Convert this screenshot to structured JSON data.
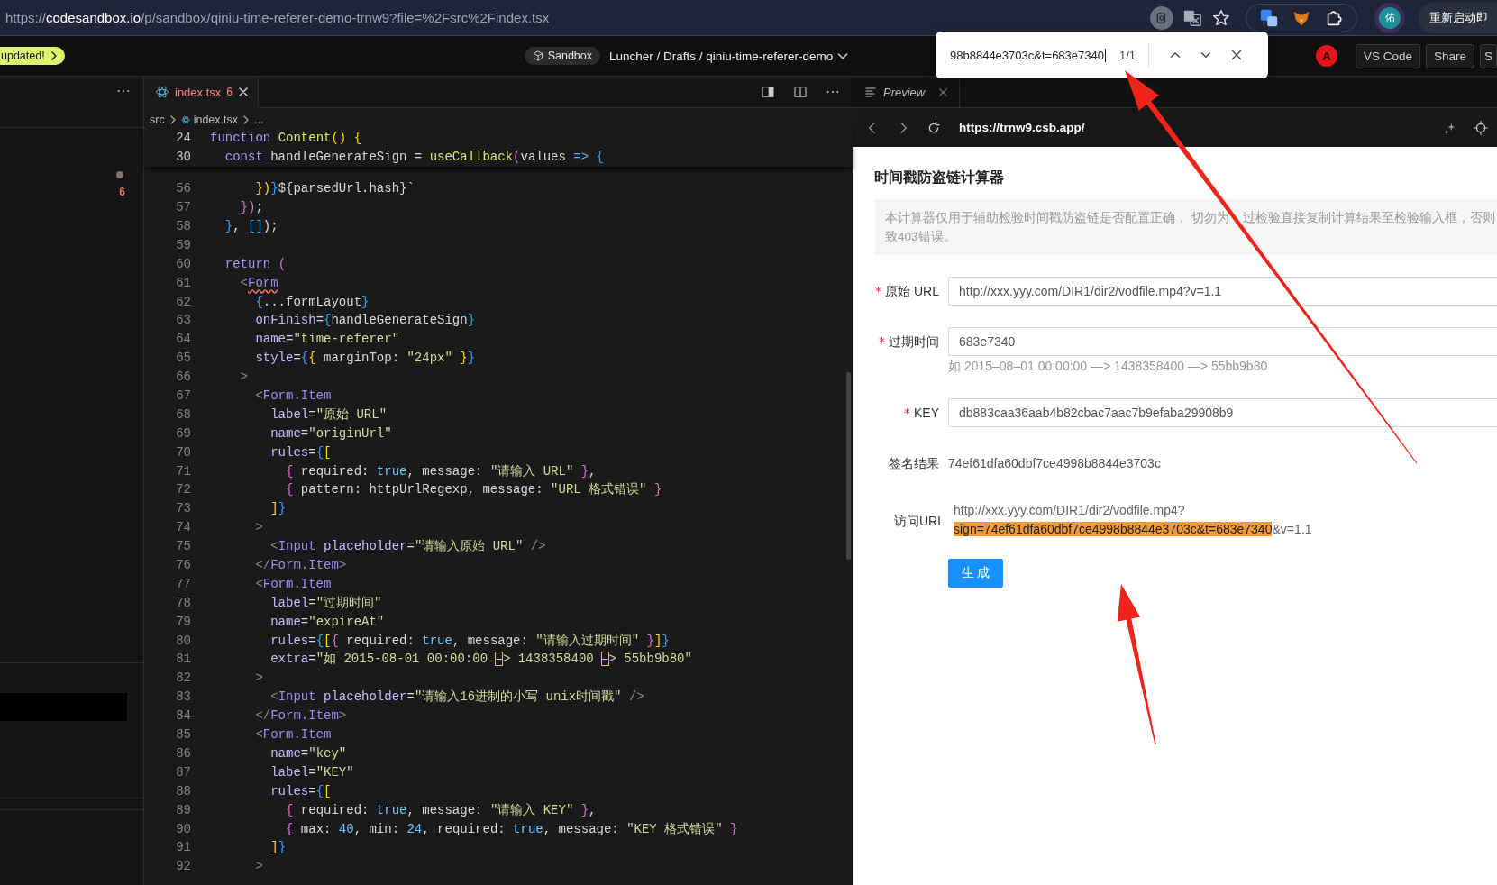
{
  "browser": {
    "url_scheme": "https://",
    "url_host": "codesandbox.io",
    "url_path": "/p/sandbox/qiniu-time-referer-demo-trnw9?file=%2Fsrc%2Findex.tsx",
    "profile_initial": "佑",
    "relaunch_button": "重新启动即"
  },
  "header": {
    "update_badge": "updated!",
    "sandbox_badge": "Sandbox",
    "breadcrumb": "Luncher / Drafts / qiniu-time-referer-demo",
    "avatar_initial": "A",
    "buttons": [
      "VS Code",
      "Share",
      "S"
    ]
  },
  "find_widget": {
    "query": "98b8844e3703c&t=683e7340",
    "match_count": "1/1"
  },
  "sidebar": {
    "problem_count": "6"
  },
  "editor": {
    "tab": {
      "label": "index.tsx",
      "problems": "6"
    },
    "breadcrumb": [
      "src",
      "index.tsx",
      "..."
    ],
    "sticky_lines": [
      {
        "number": "24",
        "tokens": [
          {
            "kind": "keyword",
            "text": "function "
          },
          {
            "kind": "function",
            "text": "Content"
          },
          {
            "kind": "bracket1",
            "text": "() {"
          }
        ]
      },
      {
        "number": "30",
        "tokens": [
          {
            "kind": "keyword",
            "text": "  const"
          },
          {
            "kind": "plain",
            "text": " handleGenerateSign = "
          },
          {
            "kind": "function",
            "text": "useCallback"
          },
          {
            "kind": "bracket2",
            "text": "("
          },
          {
            "kind": "plain",
            "text": "values "
          },
          {
            "kind": "op",
            "text": "=> "
          },
          {
            "kind": "bracket3",
            "text": "{"
          }
        ]
      }
    ],
    "lines": [
      {
        "number": "56",
        "tokens": [
          {
            "kind": "bracket1",
            "text": "      })"
          },
          {
            "kind": "bracket3",
            "text": "}"
          },
          {
            "kind": "plain",
            "text": "${parsedUrl.hash}`"
          }
        ]
      },
      {
        "number": "57",
        "tokens": [
          {
            "kind": "bracket2",
            "text": "    })"
          },
          {
            "kind": "plain",
            "text": ";"
          }
        ]
      },
      {
        "number": "58",
        "tokens": [
          {
            "kind": "bracket3",
            "text": "  }"
          },
          {
            "kind": "plain",
            "text": ", "
          },
          {
            "kind": "bracket3",
            "text": "[]"
          },
          {
            "kind": "plain",
            "text": ");"
          }
        ]
      },
      {
        "number": "59"
      },
      {
        "number": "60",
        "tokens": [
          {
            "kind": "keyword",
            "text": "  return "
          },
          {
            "kind": "bracket2",
            "text": "("
          }
        ]
      },
      {
        "number": "61",
        "tokens": [
          {
            "kind": "punct",
            "text": "    <"
          },
          {
            "kind": "tag-error",
            "text": "Form"
          }
        ]
      },
      {
        "number": "62",
        "tokens": [
          {
            "kind": "bracket3",
            "text": "      {"
          },
          {
            "kind": "plain",
            "text": "...formLayout"
          },
          {
            "kind": "bracket3",
            "text": "}"
          }
        ]
      },
      {
        "number": "63",
        "tokens": [
          {
            "kind": "attr",
            "text": "      onFinish"
          },
          {
            "kind": "plain",
            "text": "="
          },
          {
            "kind": "bracket3",
            "text": "{"
          },
          {
            "kind": "plain",
            "text": "handleGenerateSign"
          },
          {
            "kind": "bracket3",
            "text": "}"
          }
        ]
      },
      {
        "number": "64",
        "tokens": [
          {
            "kind": "attr",
            "text": "      name"
          },
          {
            "kind": "plain",
            "text": "="
          },
          {
            "kind": "string",
            "text": "\"time-referer\""
          }
        ]
      },
      {
        "number": "65",
        "tokens": [
          {
            "kind": "attr",
            "text": "      style"
          },
          {
            "kind": "plain",
            "text": "="
          },
          {
            "kind": "bracket3",
            "text": "{"
          },
          {
            "kind": "bracket1",
            "text": "{"
          },
          {
            "kind": "plain",
            "text": " marginTop: "
          },
          {
            "kind": "string",
            "text": "\"24px\""
          },
          {
            "kind": "bracket1",
            "text": " }"
          },
          {
            "kind": "bracket3",
            "text": "}"
          }
        ]
      },
      {
        "number": "66",
        "tokens": [
          {
            "kind": "punct",
            "text": "    >"
          }
        ]
      },
      {
        "number": "67",
        "tokens": [
          {
            "kind": "punct",
            "text": "      <"
          },
          {
            "kind": "tag",
            "text": "Form.Item"
          }
        ]
      },
      {
        "number": "68",
        "tokens": [
          {
            "kind": "attr",
            "text": "        label"
          },
          {
            "kind": "plain",
            "text": "="
          },
          {
            "kind": "string",
            "text": "\"原始 URL\""
          }
        ]
      },
      {
        "number": "69",
        "tokens": [
          {
            "kind": "attr",
            "text": "        name"
          },
          {
            "kind": "plain",
            "text": "="
          },
          {
            "kind": "string",
            "text": "\"originUrl\""
          }
        ]
      },
      {
        "number": "70",
        "tokens": [
          {
            "kind": "attr",
            "text": "        rules"
          },
          {
            "kind": "plain",
            "text": "="
          },
          {
            "kind": "bracket3",
            "text": "{"
          },
          {
            "kind": "bracket1",
            "text": "["
          }
        ]
      },
      {
        "number": "71",
        "tokens": [
          {
            "kind": "bracket2",
            "text": "          {"
          },
          {
            "kind": "plain",
            "text": " required: "
          },
          {
            "kind": "bool",
            "text": "true"
          },
          {
            "kind": "plain",
            "text": ", message: "
          },
          {
            "kind": "string",
            "text": "\"请输入 URL\""
          },
          {
            "kind": "bracket2",
            "text": " }"
          },
          {
            "kind": "plain",
            "text": ","
          }
        ]
      },
      {
        "number": "72",
        "tokens": [
          {
            "kind": "bracket2",
            "text": "          {"
          },
          {
            "kind": "plain",
            "text": " pattern: httpUrlRegexp, message: "
          },
          {
            "kind": "string",
            "text": "\"URL 格式错误\""
          },
          {
            "kind": "bracket2",
            "text": " }"
          }
        ]
      },
      {
        "number": "73",
        "tokens": [
          {
            "kind": "bracket1",
            "text": "        ]"
          },
          {
            "kind": "bracket3",
            "text": "}"
          }
        ]
      },
      {
        "number": "74",
        "tokens": [
          {
            "kind": "punct",
            "text": "      >"
          }
        ]
      },
      {
        "number": "75",
        "tokens": [
          {
            "kind": "punct",
            "text": "        <"
          },
          {
            "kind": "tag",
            "text": "Input"
          },
          {
            "kind": "attr",
            "text": " placeholder"
          },
          {
            "kind": "plain",
            "text": "="
          },
          {
            "kind": "string",
            "text": "\"请输入原始 URL\""
          },
          {
            "kind": "punct",
            "text": " />"
          }
        ]
      },
      {
        "number": "76",
        "tokens": [
          {
            "kind": "punct",
            "text": "      </"
          },
          {
            "kind": "tag",
            "text": "Form.Item"
          },
          {
            "kind": "punct",
            "text": ">"
          }
        ]
      },
      {
        "number": "77",
        "tokens": [
          {
            "kind": "punct",
            "text": "      <"
          },
          {
            "kind": "tag",
            "text": "Form.Item"
          }
        ]
      },
      {
        "number": "78",
        "tokens": [
          {
            "kind": "attr",
            "text": "        label"
          },
          {
            "kind": "plain",
            "text": "="
          },
          {
            "kind": "string",
            "text": "\"过期时间\""
          }
        ]
      },
      {
        "number": "79",
        "tokens": [
          {
            "kind": "attr",
            "text": "        name"
          },
          {
            "kind": "plain",
            "text": "="
          },
          {
            "kind": "string",
            "text": "\"expireAt\""
          }
        ]
      },
      {
        "number": "80",
        "tokens": [
          {
            "kind": "attr",
            "text": "        rules"
          },
          {
            "kind": "plain",
            "text": "="
          },
          {
            "kind": "bracket3",
            "text": "{"
          },
          {
            "kind": "bracket1",
            "text": "["
          },
          {
            "kind": "bracket2",
            "text": "{"
          },
          {
            "kind": "plain",
            "text": " required: "
          },
          {
            "kind": "bool",
            "text": "true"
          },
          {
            "kind": "plain",
            "text": ", message: "
          },
          {
            "kind": "string",
            "text": "\"请输入过期时间\""
          },
          {
            "kind": "bracket2",
            "text": " }"
          },
          {
            "kind": "bracket1",
            "text": "]"
          },
          {
            "kind": "bracket3",
            "text": "}"
          }
        ]
      },
      {
        "number": "81",
        "tokens": [
          {
            "kind": "attr",
            "text": "        extra"
          },
          {
            "kind": "plain",
            "text": "="
          },
          {
            "kind": "string",
            "text": "\"如 2015-08-01 00:00:00 "
          },
          {
            "kind": "flagged",
            "text": "–"
          },
          {
            "kind": "string",
            "text": "> 1438358400 "
          },
          {
            "kind": "flagged",
            "text": "–"
          },
          {
            "kind": "string",
            "text": "> 55bb9b80\""
          }
        ]
      },
      {
        "number": "82",
        "tokens": [
          {
            "kind": "punct",
            "text": "      >"
          }
        ]
      },
      {
        "number": "83",
        "tokens": [
          {
            "kind": "punct",
            "text": "        <"
          },
          {
            "kind": "tag",
            "text": "Input"
          },
          {
            "kind": "attr",
            "text": " placeholder"
          },
          {
            "kind": "plain",
            "text": "="
          },
          {
            "kind": "string",
            "text": "\"请输入16进制的小写 unix时间戳\""
          },
          {
            "kind": "punct",
            "text": " />"
          }
        ]
      },
      {
        "number": "84",
        "tokens": [
          {
            "kind": "punct",
            "text": "      </"
          },
          {
            "kind": "tag",
            "text": "Form.Item"
          },
          {
            "kind": "punct",
            "text": ">"
          }
        ]
      },
      {
        "number": "85",
        "tokens": [
          {
            "kind": "punct",
            "text": "      <"
          },
          {
            "kind": "tag",
            "text": "Form.Item"
          }
        ]
      },
      {
        "number": "86",
        "tokens": [
          {
            "kind": "attr",
            "text": "        name"
          },
          {
            "kind": "plain",
            "text": "="
          },
          {
            "kind": "string",
            "text": "\"key\""
          }
        ]
      },
      {
        "number": "87",
        "tokens": [
          {
            "kind": "attr",
            "text": "        label"
          },
          {
            "kind": "plain",
            "text": "="
          },
          {
            "kind": "string",
            "text": "\"KEY\""
          }
        ]
      },
      {
        "number": "88",
        "tokens": [
          {
            "kind": "attr",
            "text": "        rules"
          },
          {
            "kind": "plain",
            "text": "="
          },
          {
            "kind": "bracket3",
            "text": "{"
          },
          {
            "kind": "bracket1",
            "text": "["
          }
        ]
      },
      {
        "number": "89",
        "tokens": [
          {
            "kind": "bracket2",
            "text": "          {"
          },
          {
            "kind": "plain",
            "text": " required: "
          },
          {
            "kind": "bool",
            "text": "true"
          },
          {
            "kind": "plain",
            "text": ", message: "
          },
          {
            "kind": "string",
            "text": "\"请输入 KEY\""
          },
          {
            "kind": "bracket2",
            "text": " }"
          },
          {
            "kind": "plain",
            "text": ","
          }
        ]
      },
      {
        "number": "90",
        "tokens": [
          {
            "kind": "bracket2",
            "text": "          {"
          },
          {
            "kind": "plain",
            "text": " max: "
          },
          {
            "kind": "number",
            "text": "40"
          },
          {
            "kind": "plain",
            "text": ", min: "
          },
          {
            "kind": "number",
            "text": "24"
          },
          {
            "kind": "plain",
            "text": ", required: "
          },
          {
            "kind": "bool",
            "text": "true"
          },
          {
            "kind": "plain",
            "text": ", message: "
          },
          {
            "kind": "string",
            "text": "\"KEY 格式错误\""
          },
          {
            "kind": "bracket2",
            "text": " }"
          }
        ]
      },
      {
        "number": "91",
        "tokens": [
          {
            "kind": "bracket1",
            "text": "        ]"
          },
          {
            "kind": "bracket3",
            "text": "}"
          }
        ]
      },
      {
        "number": "92",
        "tokens": [
          {
            "kind": "punct",
            "text": "      >"
          }
        ]
      }
    ]
  },
  "preview": {
    "tab": "Preview",
    "address": "https://trnw9.csb.app/",
    "title": "时间戳防盗链计算器",
    "notice_lines": [
      {
        "parts": [
          "本计算器仅用于辅助检验时间戳防盗链是否配置正确， 切勿为",
          "过检验直接复制计算结果至检验输入框，否则"
        ]
      },
      {
        "parts": [
          "致403错误。"
        ]
      }
    ],
    "fields": [
      {
        "kind": "input",
        "label": "原始 URL",
        "required_mark": "*",
        "value": "http://xxx.yyy.com/DIR1/dir2/vodfile.mp4?v=1.1"
      },
      {
        "kind": "input",
        "label": "过期时间",
        "required_mark": "*",
        "value": "683e7340",
        "extra": "如 2015–08–01 00:00:00 —> 1438358400 —> 55bb9b80"
      },
      {
        "kind": "input",
        "label": "KEY",
        "required_mark": "*",
        "value": "db883caa36aab4b82cbac7aac7b9efaba29908b9"
      },
      {
        "kind": "text",
        "label": "签名结果",
        "value": "74ef61dfa60dbf7ce4998b8844e3703c"
      },
      {
        "kind": "url",
        "label": "访问URL",
        "before": "http://xxx.yyy.com/DIR1/dir2/vodfile.mp4?",
        "match": "sign=74ef61dfa60dbf7ce4998b8844e3703c&t=683e7340",
        "after": "&v=1.1"
      }
    ],
    "submit": "生 成"
  }
}
